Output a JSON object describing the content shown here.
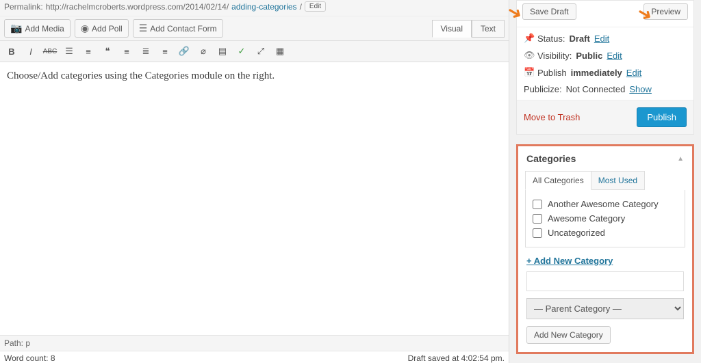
{
  "permalink": {
    "label": "Permalink:",
    "url_prefix": "http://rachelmcroberts.wordpress.com/2014/02/14/",
    "slug": "adding-categories",
    "suffix": "/",
    "edit_label": "Edit"
  },
  "media": {
    "add_media": "Add Media",
    "add_poll": "Add Poll",
    "add_contact_form": "Add Contact Form"
  },
  "editor_tabs": {
    "visual": "Visual",
    "text": "Text"
  },
  "content": "Choose/Add categories using the Categories module on the right.",
  "bottom": {
    "path_label": "Path:",
    "path_value": "p",
    "word_count_label": "Word count:",
    "word_count": "8",
    "save_status": "Draft saved at 4:02:54 pm."
  },
  "publish": {
    "save_draft": "Save Draft",
    "preview": "Preview",
    "status_label": "Status:",
    "status_value": "Draft",
    "visibility_label": "Visibility:",
    "visibility_value": "Public",
    "publish_label": "Publish",
    "publish_value": "immediately",
    "publicize_label": "Publicize:",
    "publicize_value": "Not Connected",
    "publicize_action": "Show",
    "edit": "Edit",
    "trash": "Move to Trash",
    "publish_btn": "Publish"
  },
  "categories": {
    "title": "Categories",
    "tab_all": "All Categories",
    "tab_most": "Most Used",
    "items": [
      {
        "label": "Another Awesome Category"
      },
      {
        "label": "Awesome Category"
      },
      {
        "label": "Uncategorized"
      }
    ],
    "add_link": "+ Add New Category",
    "parent_placeholder": "— Parent Category —",
    "add_btn": "Add New Category"
  }
}
